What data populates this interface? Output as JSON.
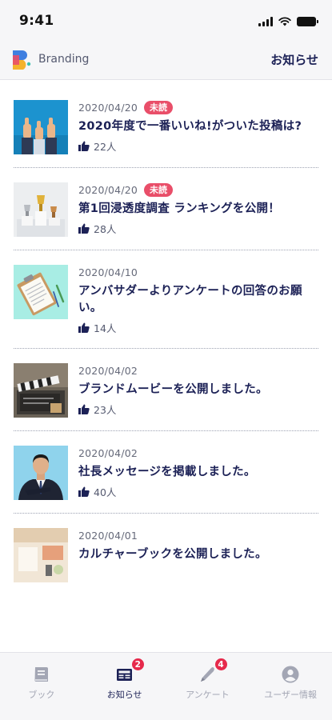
{
  "status_bar": {
    "time": "9:41"
  },
  "header": {
    "brand": "Branding",
    "notice_link": "お知らせ"
  },
  "articles": [
    {
      "date": "2020/04/20",
      "badge": "未読",
      "title": "2020年度で一番いいね!がついた投稿は?",
      "likes": "22人",
      "thumb_icon": "thumbs-up-photo"
    },
    {
      "date": "2020/04/20",
      "badge": "未読",
      "title": "第1回浸透度調査 ランキングを公開！",
      "likes": "28人",
      "thumb_icon": "trophy-photo"
    },
    {
      "date": "2020/04/10",
      "badge": "",
      "title": "アンバサダーよりアンケートの回答のお願い。",
      "likes": "14人",
      "thumb_icon": "clipboard-photo"
    },
    {
      "date": "2020/04/02",
      "badge": "",
      "title": "ブランドムービーを公開しました。",
      "likes": "23人",
      "thumb_icon": "clapperboard-photo"
    },
    {
      "date": "2020/04/02",
      "badge": "",
      "title": "社長メッセージを掲載しました。",
      "likes": "40人",
      "thumb_icon": "businessman-photo"
    },
    {
      "date": "2020/04/01",
      "badge": "",
      "title": "カルチャーブックを公開しました。",
      "likes": "",
      "thumb_icon": "desk-photo"
    }
  ],
  "tabs": [
    {
      "label": "ブック",
      "icon": "book-icon",
      "badge": ""
    },
    {
      "label": "お知らせ",
      "icon": "newspaper-icon",
      "badge": "2"
    },
    {
      "label": "アンケート",
      "icon": "pen-icon",
      "badge": "4"
    },
    {
      "label": "ユーザー情報",
      "icon": "user-icon",
      "badge": ""
    }
  ],
  "colors": {
    "navy": "#1c2156",
    "unread_badge": "#e94e69",
    "tab_badge": "#e6294b",
    "inactive": "#a3a6b4"
  }
}
